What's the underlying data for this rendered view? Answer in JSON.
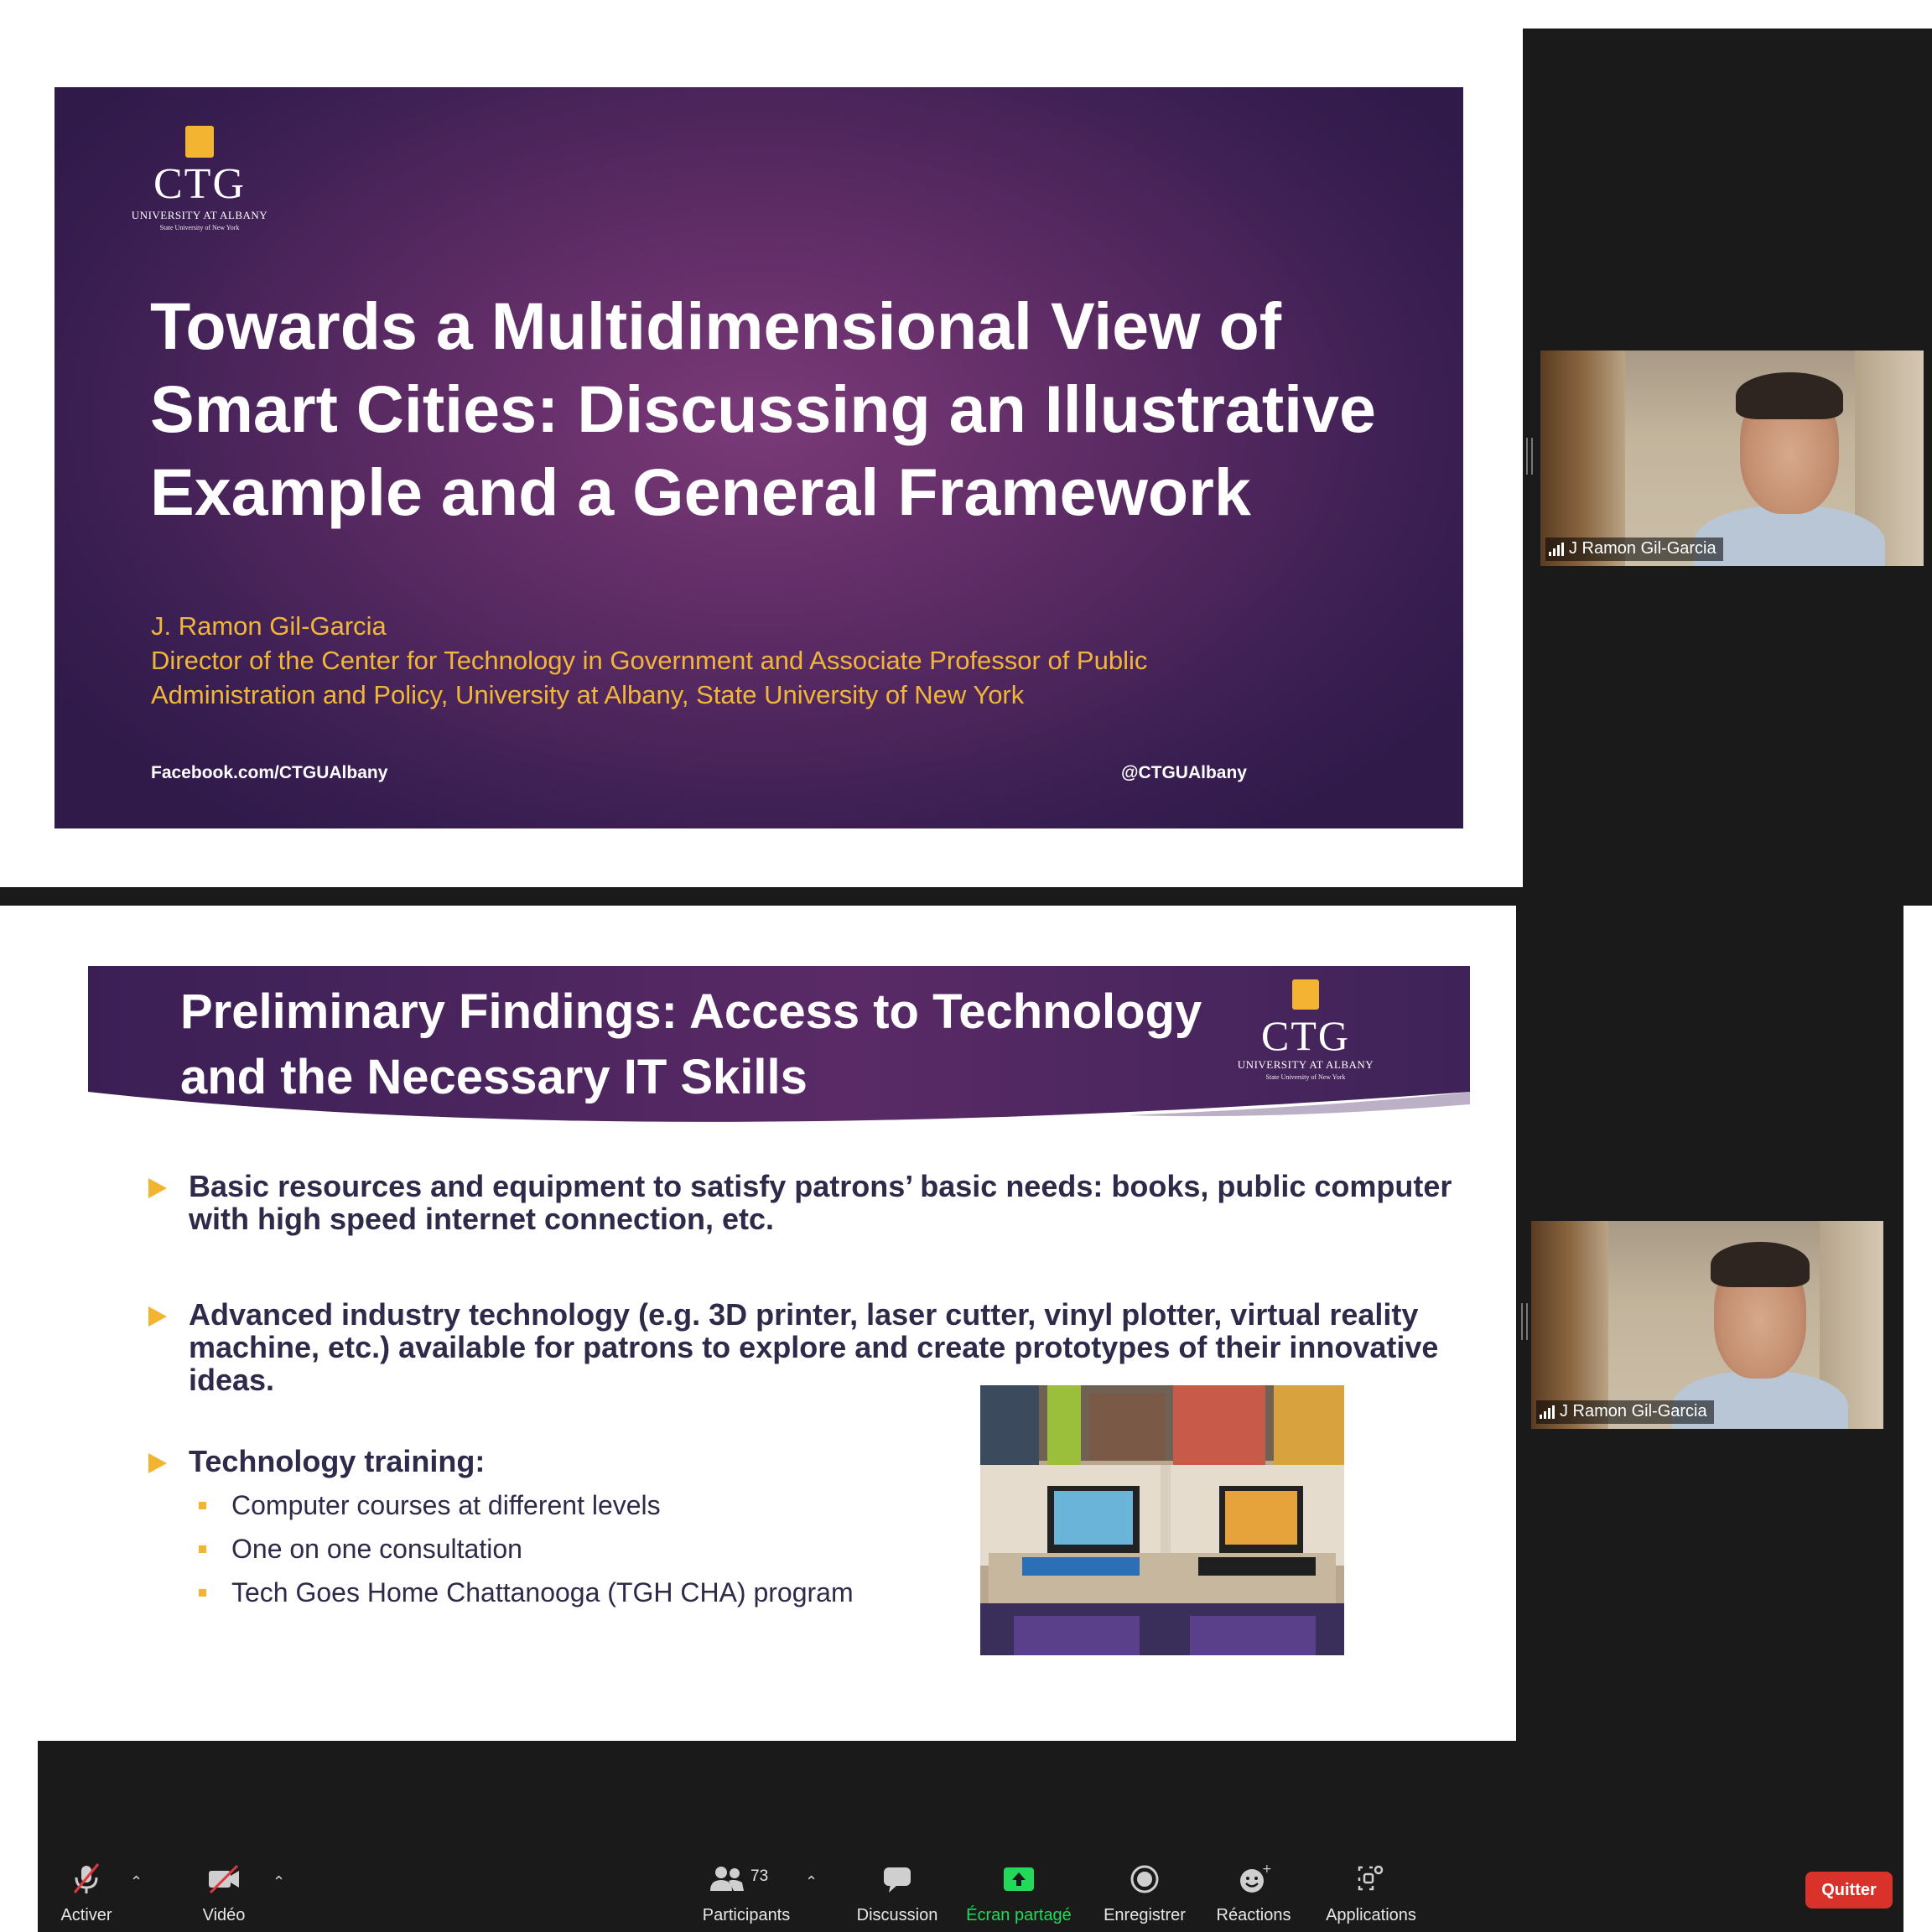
{
  "top_slide": {
    "logo_name": "CTG",
    "logo_university": "UNIVERSITY AT ALBANY",
    "logo_suny": "State University of New York",
    "title": "Towards a Multidimensional View of Smart Cities: Discussing an Illustrative Example and a General Framework",
    "author": "J. Ramon Gil-Garcia",
    "affiliation": "Director of the Center for Technology in Government and Associate Professor of Public Administration and Policy, University at Albany, State University of New York",
    "facebook": "Facebook.com/CTGUAlbany",
    "twitter": "@CTGUAlbany"
  },
  "top_video": {
    "participant_name": "J Ramon Gil-Garcia"
  },
  "bottom_slide": {
    "title": "Preliminary Findings: Access to Technology and the Necessary IT Skills",
    "logo_name": "CTG",
    "logo_university": "UNIVERSITY AT ALBANY",
    "logo_suny": "State University of New York",
    "bullets": [
      "Basic resources and equipment to satisfy patrons’ basic needs: books, public computer with high speed internet connection, etc.",
      "Advanced industry technology (e.g. 3D printer, laser cutter, vinyl plotter, virtual reality machine, etc.) available for patrons to explore and create prototypes of their innovative ideas.",
      "Technology training:"
    ],
    "sub_bullets": [
      "Computer courses at different levels",
      "One on one consultation",
      "Tech Goes Home Chattanooga (TGH CHA) program"
    ]
  },
  "bottom_video": {
    "participant_name": "J Ramon Gil-Garcia"
  },
  "toolbar": {
    "mute_label": "Activer",
    "video_label": "Vidéo",
    "participants_label": "Participants",
    "participants_count": "73",
    "chat_label": "Discussion",
    "share_label": "Écran partagé",
    "record_label": "Enregistrer",
    "reactions_label": "Réactions",
    "apps_label": "Applications",
    "leave_label": "Quitter",
    "share_color": "#23d959",
    "leave_color": "#d9322b"
  }
}
